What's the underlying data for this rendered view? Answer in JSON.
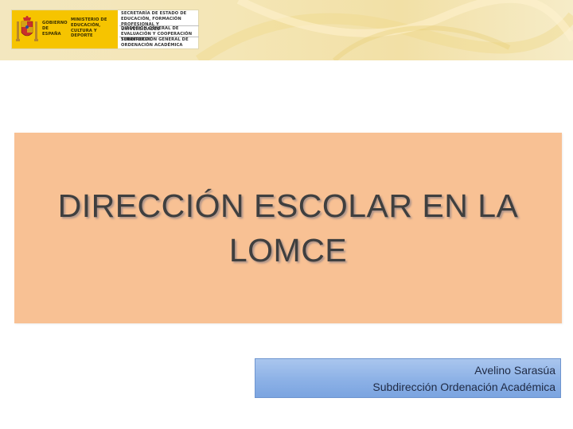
{
  "header": {
    "logo": {
      "government": "GOBIERNO DE ESPAÑA",
      "ministry": "MINISTERIO DE EDUCACIÓN, CULTURA Y DEPORTE",
      "secretariat": "SECRETARÍA DE ESTADO DE EDUCACIÓN, FORMACIÓN PROFESIONAL Y UNIVERSIDADES",
      "directorate": "DIRECCIÓN GENERAL DE EVALUACIÓN Y COOPERACIÓN TERRITORIAL",
      "subdirectorate": "SUBDIRECCIÓN GENERAL DE ORDENACIÓN ACADÉMICA"
    },
    "band_color": "#f3e7bf",
    "logo_yellow": "#f6c400"
  },
  "title": {
    "text": "DIRECCIÓN ESCOLAR EN LA\nLOMCE",
    "box_color": "#f8c194"
  },
  "author": {
    "name": "Avelino Sarasúa",
    "department": "Subdirección Ordenación Académica",
    "box_color": "#8cb1e6"
  }
}
